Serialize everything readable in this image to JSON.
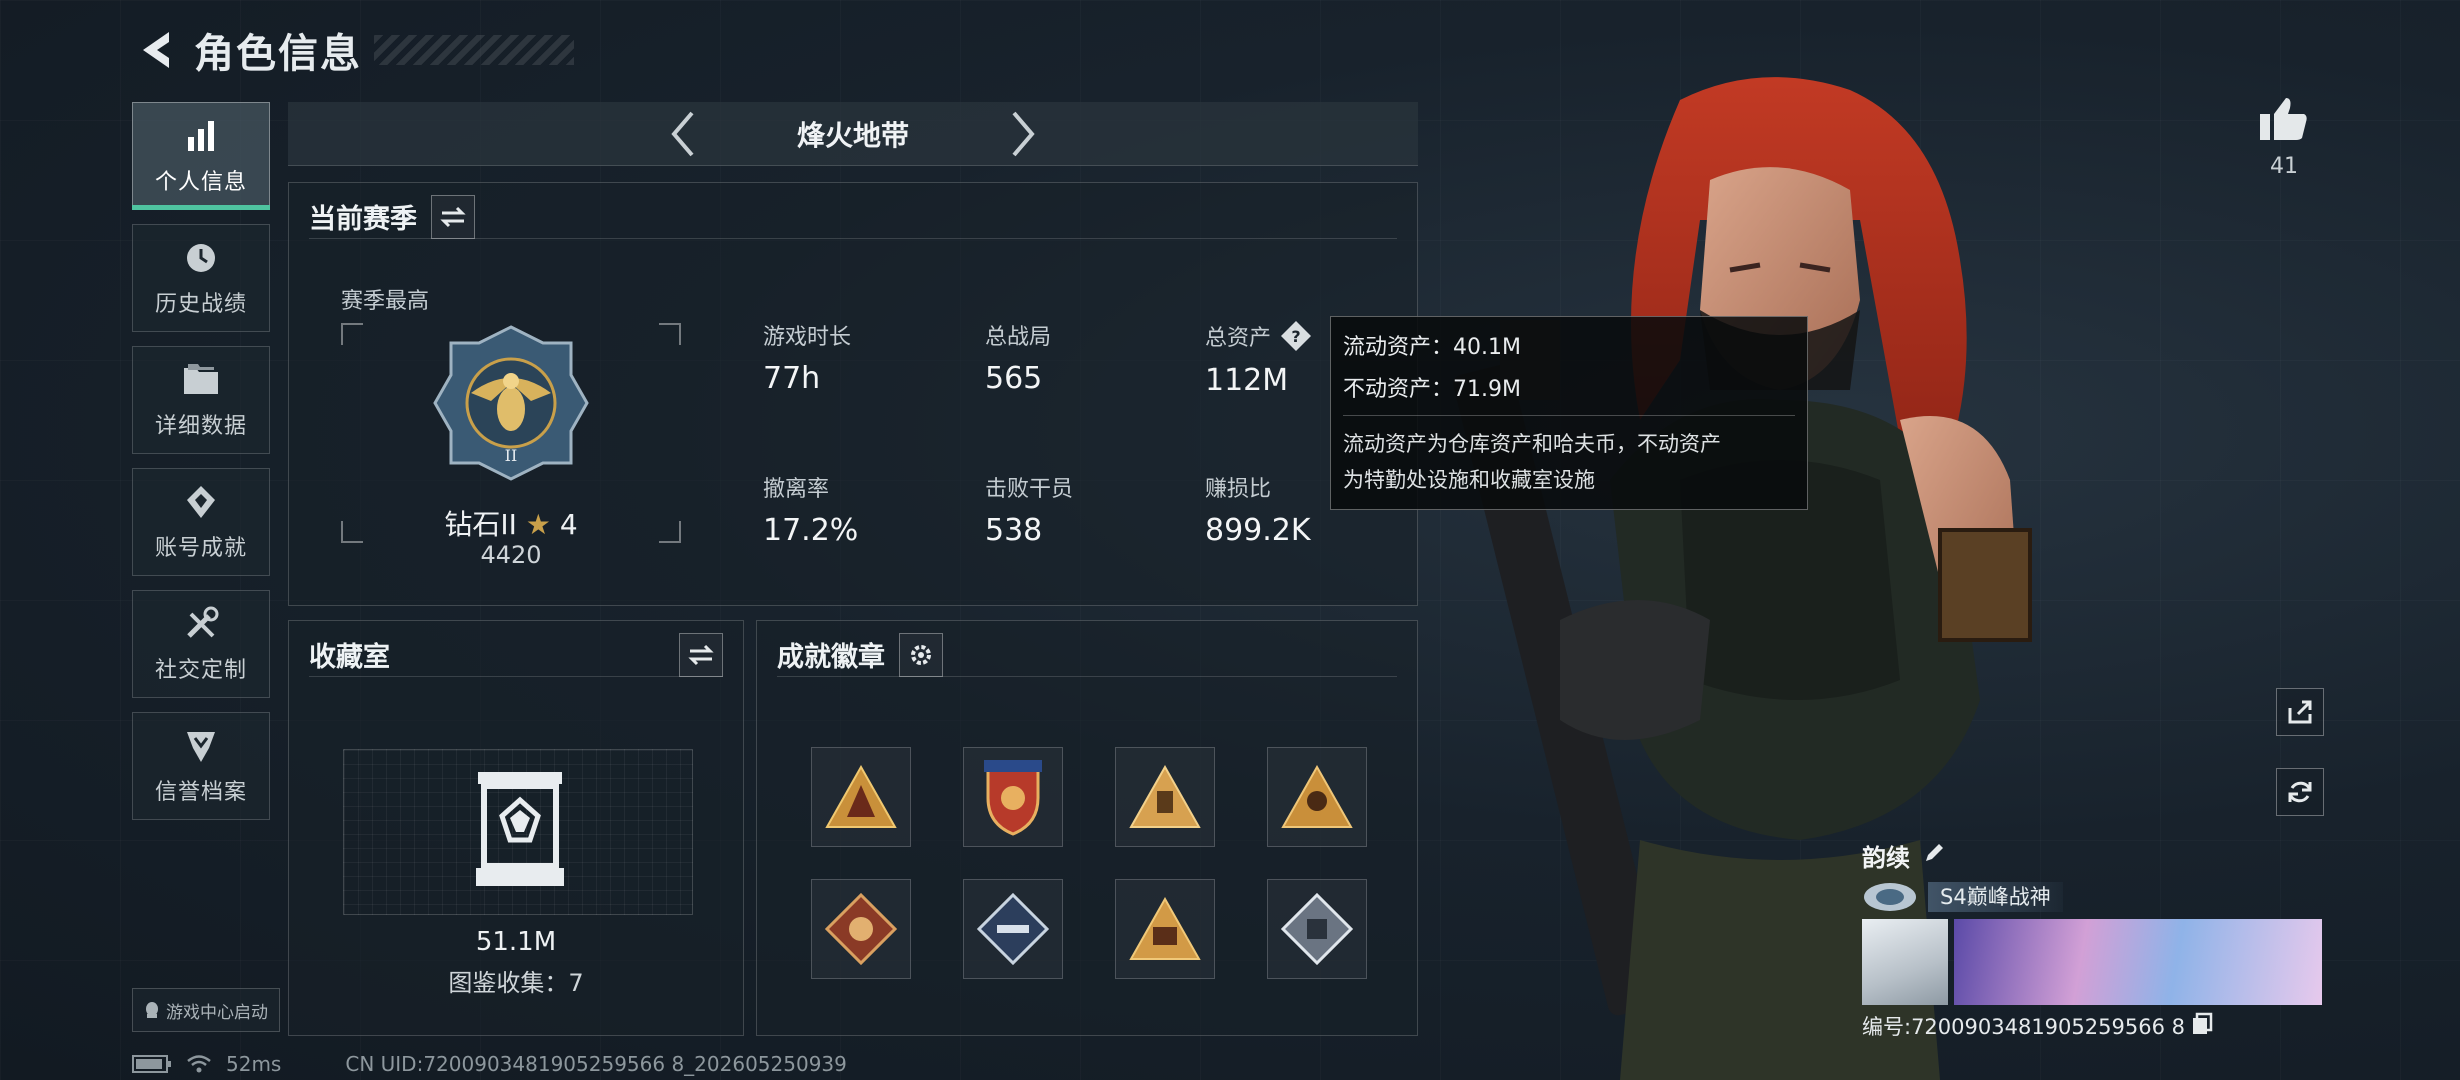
{
  "header": {
    "title": "角色信息"
  },
  "sidebar": {
    "items": [
      {
        "label": "个人信息",
        "icon": "bar-chart-icon",
        "active": true
      },
      {
        "label": "历史战绩",
        "icon": "history-icon",
        "active": false
      },
      {
        "label": "详细数据",
        "icon": "folder-icon",
        "active": false
      },
      {
        "label": "账号成就",
        "icon": "achievement-icon",
        "active": false
      },
      {
        "label": "社交定制",
        "icon": "tools-icon",
        "active": false
      },
      {
        "label": "信誉档案",
        "icon": "reputation-icon",
        "active": false
      }
    ],
    "game_center": "游戏中心启动"
  },
  "mode": {
    "title": "烽火地带"
  },
  "season": {
    "title": "当前赛季",
    "best_label": "赛季最高",
    "rank_name": "钻石II",
    "rank_stars": "4",
    "rank_score": "4420",
    "stats": [
      {
        "label": "游戏时长",
        "value": "77h"
      },
      {
        "label": "总战局",
        "value": "565"
      },
      {
        "label": "总资产",
        "value": "112M"
      },
      {
        "label": "撤离率",
        "value": "17.2%"
      },
      {
        "label": "击败干员",
        "value": "538"
      },
      {
        "label": "赚损比",
        "value": "899.2K"
      }
    ]
  },
  "tooltip": {
    "liquid": "流动资产：40.1M",
    "fixed": "不动资产：71.9M",
    "desc_line1": "流动资产为仓库资产和哈夫币，不动资产",
    "desc_line2": "为特勤处设施和收藏室设施"
  },
  "collection": {
    "title": "收藏室",
    "value": "51.1M",
    "count": "图鉴收集：7"
  },
  "badges": {
    "title": "成就徽章",
    "items": [
      "badge-1",
      "badge-2",
      "badge-3",
      "badge-4",
      "badge-5",
      "badge-6",
      "badge-7",
      "badge-8"
    ]
  },
  "status": {
    "ping": "52ms",
    "uid": "CN UID:7200903481905259566 8_202605250939"
  },
  "profile": {
    "name": "韵续",
    "title": "S4巅峰战神",
    "id": "编号:7200903481905259566 8",
    "likes": "41"
  },
  "colors": {
    "accent": "#4fc4a0",
    "gold": "#c9a04a",
    "hair": "#b8321f"
  }
}
